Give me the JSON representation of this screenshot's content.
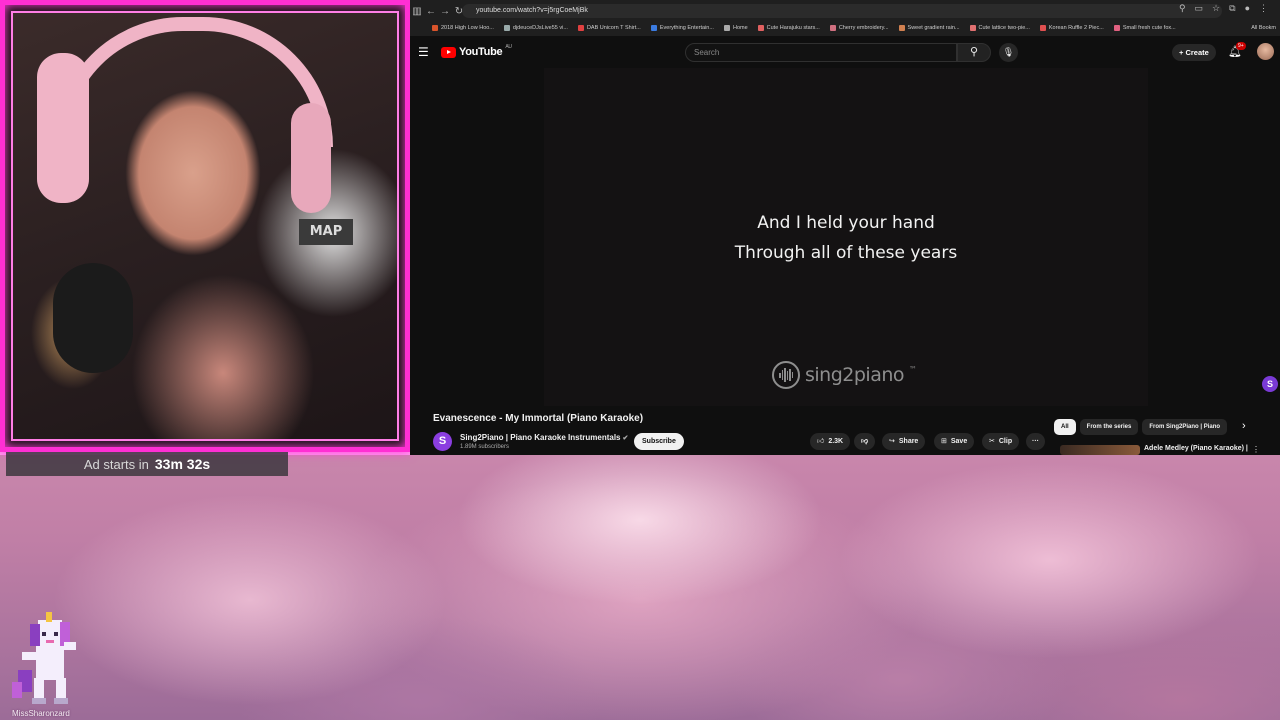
{
  "stream_overlay": {
    "ad_label": "Ad starts in",
    "ad_time": "33m 32s",
    "streamer_name": "MissSharonzard"
  },
  "webcam": {
    "chair_logo": "MAP"
  },
  "browser": {
    "url": "youtube.com/watch?v=j5rgCoeMjBk",
    "bookmarks": [
      "2018 High Low Hoo...",
      "djdeuceDJsLive55 vi...",
      "DAB Unicorn T Shirt...",
      "Everything Entertain...",
      "Home",
      "Cute Harajuku stars...",
      "Cherry embroidery...",
      "Sweet gradient rain...",
      "Cute lattice two-pie...",
      "Korean Ruffle 2 Piec...",
      "Small fresh cute fox..."
    ],
    "all_bookmarks": "All Bookm"
  },
  "youtube": {
    "logo_text": "YouTube",
    "region": "AU",
    "search_placeholder": "Search",
    "create_label": "Create",
    "notification_count": "9+",
    "player": {
      "lyrics_line1": "And I held your hand",
      "lyrics_line2": "Through all of these years",
      "brand": "sing2piano",
      "brand_tm": "™"
    },
    "video": {
      "title": "Evanescence - My Immortal (Piano Karaoke)",
      "channel": "Sing2Piano | Piano Karaoke Instrumentals",
      "channel_initial": "S",
      "subscribers": "1.89M subscribers",
      "subscribe_label": "Subscribe",
      "likes": "2.3K",
      "share_label": "Share",
      "save_label": "Save",
      "clip_label": "Clip"
    },
    "chips": [
      "All",
      "From the series",
      "From Sing2Piano | Piano"
    ],
    "recommendation": {
      "title": "Adele Medley (Piano Karaoke) |"
    }
  },
  "colors": {
    "frame_neon": "#ff2fd4",
    "youtube_red": "#ff0000",
    "player_bg": "#141213"
  }
}
